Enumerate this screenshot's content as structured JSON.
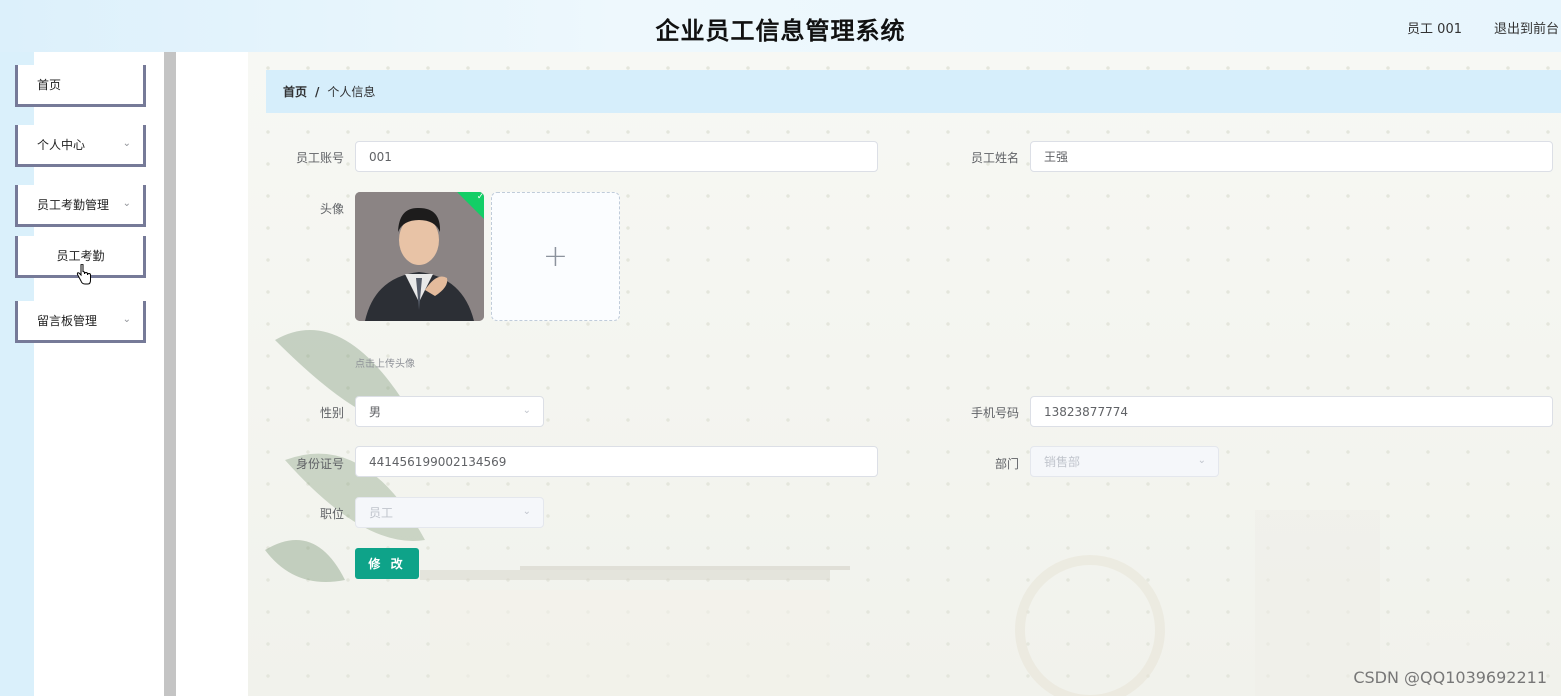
{
  "header": {
    "title": "企业员工信息管理系统",
    "user": "员工 001",
    "logout": "退出到前台"
  },
  "sidebar": {
    "items": [
      {
        "label": "首页",
        "has_arrow": false
      },
      {
        "label": "个人中心",
        "has_arrow": true
      },
      {
        "label": "员工考勤管理",
        "has_arrow": true
      },
      {
        "label": "员工考勤",
        "has_arrow": false
      },
      {
        "label": "留言板管理",
        "has_arrow": true
      }
    ]
  },
  "breadcrumb": {
    "home": "首页",
    "separator": "/",
    "current": "个人信息"
  },
  "form": {
    "account": {
      "label": "员工账号",
      "value": "001"
    },
    "name": {
      "label": "员工姓名",
      "value": "王强"
    },
    "avatar": {
      "label": "头像",
      "upload_tip": "点击上传头像",
      "plus": "+"
    },
    "gender": {
      "label": "性别",
      "value": "男"
    },
    "phone": {
      "label": "手机号码",
      "value": "13823877774"
    },
    "id_card": {
      "label": "身份证号",
      "value": "441456199002134569"
    },
    "department": {
      "label": "部门",
      "value": "销售部"
    },
    "position": {
      "label": "职位",
      "value": "员工"
    },
    "submit_label": "修 改"
  },
  "watermark": "CSDN @QQ1039692211",
  "icons": {
    "chevron": "⌄",
    "check": "✓"
  },
  "colors": {
    "primary_button": "#0ea389",
    "breadcrumb_bg": "#d6eefb",
    "menu_border": "#767a98",
    "success": "#13ce66"
  }
}
